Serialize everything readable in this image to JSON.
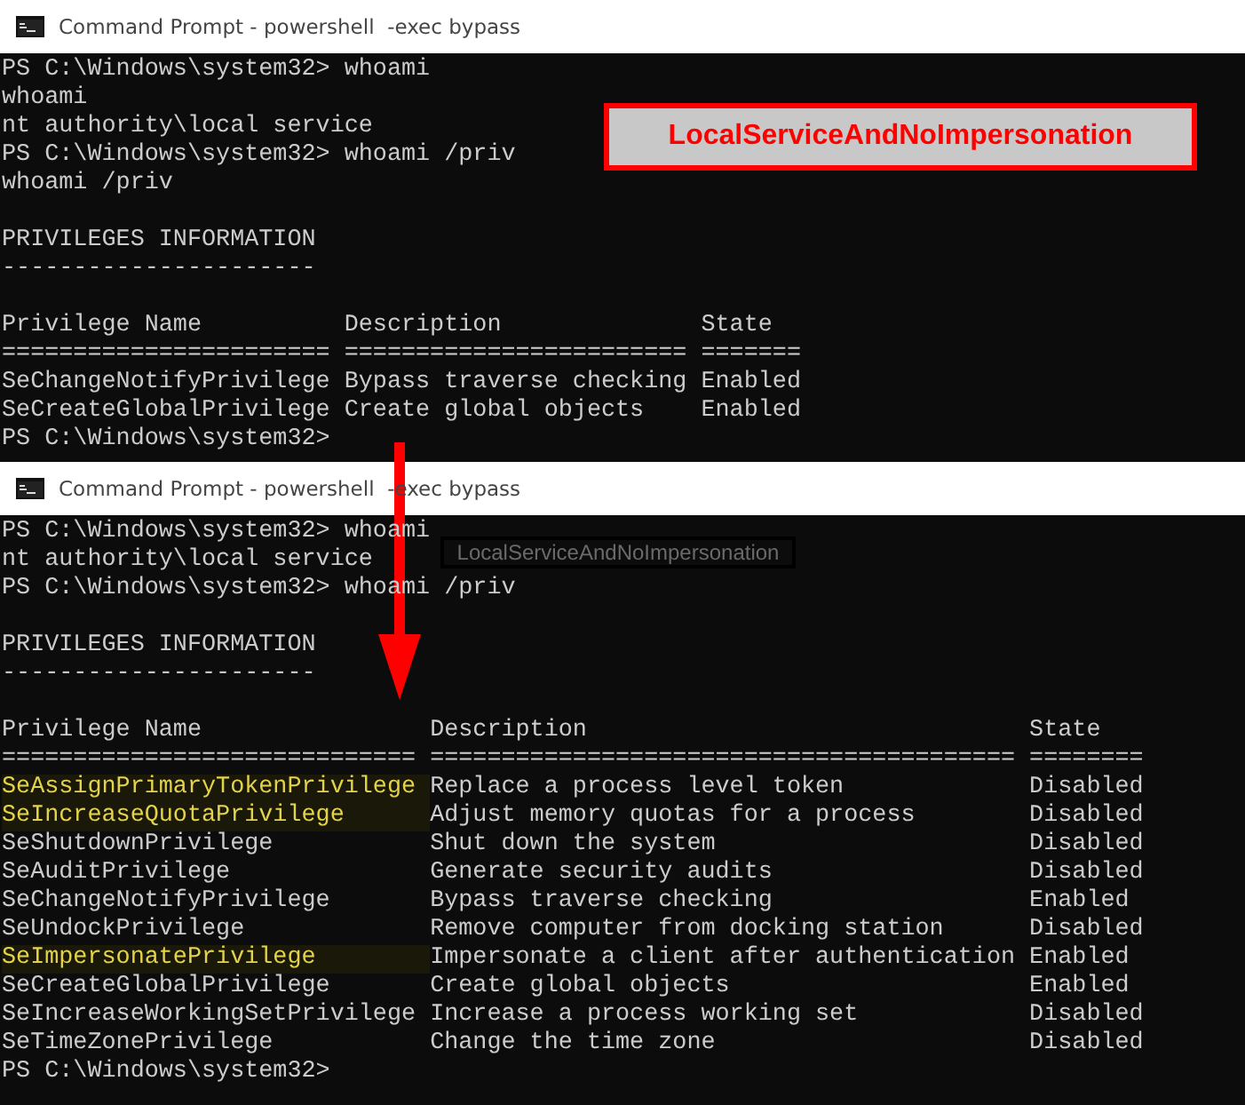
{
  "windows": [
    {
      "title": "Command Prompt - powershell  -exec bypass",
      "lines": [
        "PS C:\\Windows\\system32> whoami",
        "whoami",
        "nt authority\\local service",
        "PS C:\\Windows\\system32> whoami /priv",
        "whoami /priv"
      ],
      "heading": "PRIVILEGES INFORMATION",
      "rule": "----------------------",
      "table": {
        "columns": [
          "Privilege Name",
          "Description",
          "State"
        ],
        "separators": [
          "=======================",
          "========================",
          "======="
        ],
        "rows": [
          {
            "name": "SeChangeNotifyPrivilege",
            "description": "Bypass traverse checking",
            "state": "Enabled",
            "highlighted": false
          },
          {
            "name": "SeCreateGlobalPrivilege",
            "description": "Create global objects",
            "state": "Enabled",
            "highlighted": false
          }
        ]
      },
      "prompt": "PS C:\\Windows\\system32>",
      "annotation": {
        "text": "LocalServiceAndNoImpersonation",
        "kind": "callout"
      }
    },
    {
      "title": "Command Prompt - powershell  -exec bypass",
      "lines": [
        "PS C:\\Windows\\system32> whoami",
        "nt authority\\local service",
        "PS C:\\Windows\\system32> whoami /priv"
      ],
      "heading": "PRIVILEGES INFORMATION",
      "rule": "----------------------",
      "table": {
        "columns": [
          "Privilege Name",
          "Description",
          "State"
        ],
        "separators": [
          "=============================",
          "=========================================",
          "========"
        ],
        "rows": [
          {
            "name": "SeAssignPrimaryTokenPrivilege",
            "description": "Replace a process level token",
            "state": "Disabled",
            "highlighted": true
          },
          {
            "name": "SeIncreaseQuotaPrivilege",
            "description": "Adjust memory quotas for a process",
            "state": "Disabled",
            "highlighted": true
          },
          {
            "name": "SeShutdownPrivilege",
            "description": "Shut down the system",
            "state": "Disabled",
            "highlighted": false
          },
          {
            "name": "SeAuditPrivilege",
            "description": "Generate security audits",
            "state": "Disabled",
            "highlighted": false
          },
          {
            "name": "SeChangeNotifyPrivilege",
            "description": "Bypass traverse checking",
            "state": "Enabled",
            "highlighted": false
          },
          {
            "name": "SeUndockPrivilege",
            "description": "Remove computer from docking station",
            "state": "Disabled",
            "highlighted": false
          },
          {
            "name": "SeImpersonatePrivilege",
            "description": "Impersonate a client after authentication",
            "state": "Enabled",
            "highlighted": true
          },
          {
            "name": "SeCreateGlobalPrivilege",
            "description": "Create global objects",
            "state": "Enabled",
            "highlighted": false
          },
          {
            "name": "SeIncreaseWorkingSetPrivilege",
            "description": "Increase a process working set",
            "state": "Disabled",
            "highlighted": false
          },
          {
            "name": "SeTimeZonePrivilege",
            "description": "Change the time zone",
            "state": "Disabled",
            "highlighted": false
          }
        ]
      },
      "prompt": "PS C:\\Windows\\system32>",
      "annotation": {
        "text": "LocalServiceAndNoImpersonation",
        "kind": "faint"
      }
    }
  ]
}
